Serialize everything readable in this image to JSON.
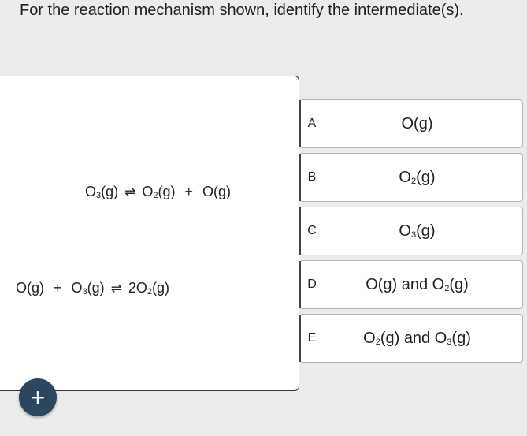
{
  "question": "For the reaction mechanism shown, identify the intermediate(s).",
  "mechanism": {
    "step1": {
      "r1": "O",
      "r1_sub": "3",
      "r1_state": "(g)",
      "arrow": "⇌",
      "p1": "O",
      "p1_sub": "2",
      "p1_state": "(g)",
      "plus": "+",
      "p2": "O(g)"
    },
    "step2": {
      "r1": "O(g)",
      "plus": "+",
      "r2": "O",
      "r2_sub": "3",
      "r2_state": "(g)",
      "arrow": "⇌",
      "p1": "2O",
      "p1_sub": "2",
      "p1_state": "(g)"
    }
  },
  "choices": [
    {
      "letter": "A",
      "parts": [
        "O(g)"
      ]
    },
    {
      "letter": "B",
      "parts": [
        "O",
        "2",
        "(g)"
      ]
    },
    {
      "letter": "C",
      "parts": [
        "O",
        "3",
        "(g)"
      ]
    },
    {
      "letter": "D",
      "parts": [
        "O(g) and O",
        "2",
        "(g)"
      ]
    },
    {
      "letter": "E",
      "parts": [
        "O",
        "2",
        "(g) and O",
        "3",
        "(g)"
      ]
    }
  ],
  "add_button": {
    "label": "+",
    "icon": "plus-icon"
  }
}
